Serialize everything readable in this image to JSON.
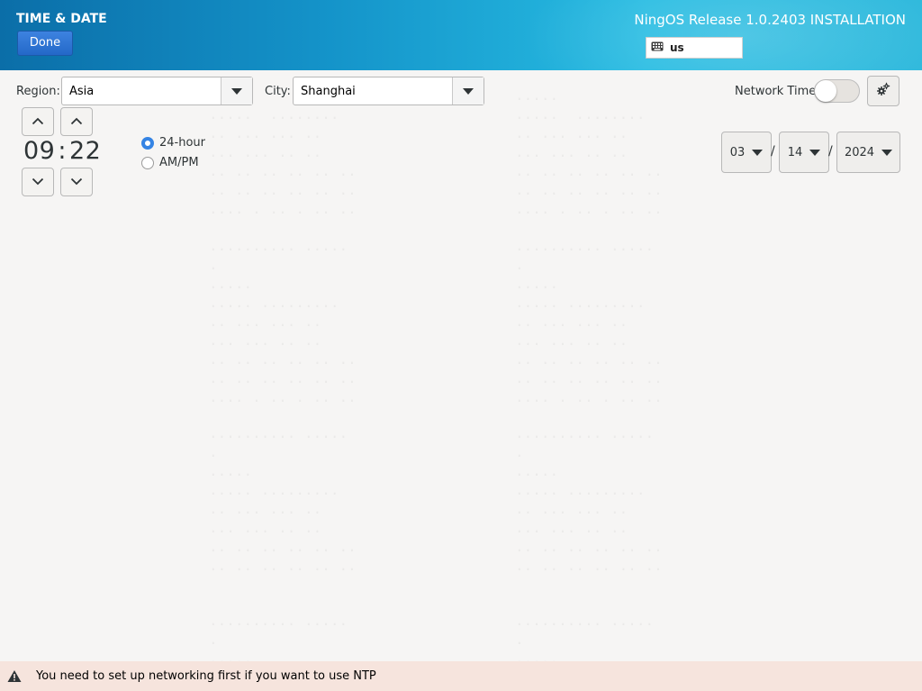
{
  "header": {
    "spoke_title": "TIME & DATE",
    "done_label": "Done",
    "install_title": "NingOS Release 1.0.2403 INSTALLATION",
    "keyboard_layout": "us"
  },
  "location": {
    "region_label": "Region:",
    "region_value": "Asia",
    "city_label": "City:",
    "city_value": "Shanghai"
  },
  "network_time": {
    "label": "Network Time",
    "enabled": false
  },
  "time": {
    "hours": "09",
    "separator": ":",
    "minutes": "22"
  },
  "format": {
    "option_24": "24-hour",
    "option_ampm": "AM/PM",
    "selected": "24-hour"
  },
  "date": {
    "month": "03",
    "day": "14",
    "year": "2024",
    "separator": "/"
  },
  "warning": {
    "message": "You need to set up networking first if you want to use NTP"
  },
  "icons": {
    "keyboard": "keyboard-icon",
    "gear": "gear-icon",
    "warning": "warning-icon",
    "up": "chevron-up-icon",
    "down": "chevron-down-icon"
  },
  "colors": {
    "accent": "#3584e4",
    "header_start": "#0b6ea8",
    "header_end": "#2fb9dc",
    "warning_bg": "#f6e4dd"
  }
}
